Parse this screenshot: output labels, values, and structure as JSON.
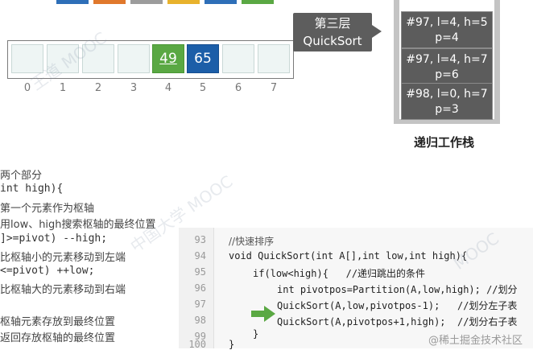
{
  "colors": {
    "green_cell": "#5aa843",
    "blue_cell": "#1c5ea8",
    "stack_frame": "#5c5c5c",
    "label_box": "#5d5d5d",
    "arrow": "#5aa843"
  },
  "array": {
    "cells": [
      {
        "value": "",
        "state": "faded"
      },
      {
        "value": "",
        "state": "faded"
      },
      {
        "value": "",
        "state": "faded"
      },
      {
        "value": "",
        "state": "faded"
      },
      {
        "value": "49",
        "state": "pivot"
      },
      {
        "value": "65",
        "state": "active"
      },
      {
        "value": "",
        "state": "faded"
      },
      {
        "value": "",
        "state": "faded"
      }
    ],
    "indices": [
      "0",
      "1",
      "2",
      "3",
      "4",
      "5",
      "6",
      "7"
    ]
  },
  "level_label": {
    "line1": "第三层",
    "line2": "QuickSort"
  },
  "stack": {
    "frames": [
      {
        "line1": "#97, l=4, h=5",
        "line2": "p=4"
      },
      {
        "line1": "#97, l=4, h=7",
        "line2": "p=6"
      },
      {
        "line1": "#98, l=0, h=7",
        "line2": "p=3"
      }
    ],
    "label": "递归工作栈"
  },
  "left_code": [
    "两个部分",
    "int high){",
    "第一个元素作为枢轴",
    "用low、high搜索枢轴的最终位置",
    "]>=pivot) --high;",
    "比枢轴小的元素移动到左端",
    "<=pivot) ++low;",
    "比枢轴大的元素移动到右端",
    "",
    "枢轴元素存放到最终位置",
    "返回存放枢轴的最终位置"
  ],
  "code": {
    "lines": [
      {
        "num": "93",
        "text": "//快速排序"
      },
      {
        "num": "94",
        "text": "void QuickSort(int A[],int low,int high){"
      },
      {
        "num": "95",
        "text": "if(low<high){   //递归跳出的条件"
      },
      {
        "num": "96",
        "text": "int pivotpos=Partition(A,low,high); //划分"
      },
      {
        "num": "97",
        "text": "QuickSort(A,low,pivotpos-1);   //划分左子表"
      },
      {
        "num": "98",
        "text": "QuickSort(A,pivotpos+1,high);  //划分右子表"
      },
      {
        "num": "99",
        "text": "}"
      },
      {
        "num": "100",
        "text": "}"
      }
    ]
  },
  "credit": "@稀土掘金技术社区"
}
